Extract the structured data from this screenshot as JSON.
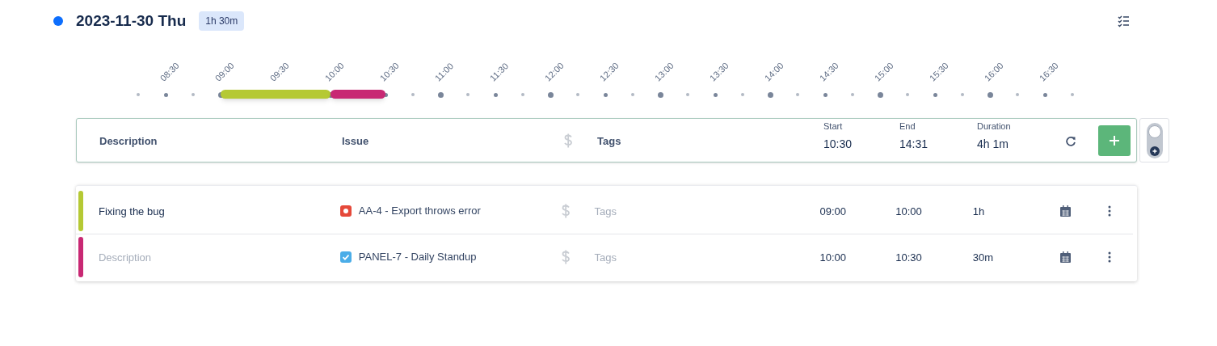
{
  "day": {
    "title": "2023-11-30 Thu",
    "total": "1h 30m",
    "color": "#0d6efd"
  },
  "timeline": {
    "ticks": [
      "08:30",
      "09:00",
      "09:30",
      "10:00",
      "10:30",
      "11:00",
      "11:30",
      "12:00",
      "12:30",
      "13:00",
      "13:30",
      "14:00",
      "14:30",
      "15:00",
      "15:30",
      "16:00",
      "16:30"
    ]
  },
  "form": {
    "description_placeholder": "Description",
    "issue_placeholder": "Issue",
    "tags_placeholder": "Tags",
    "start_label": "Start",
    "start": "10:30",
    "end_label": "End",
    "end": "14:31",
    "duration_label": "Duration",
    "duration": "4h 1m",
    "toggle_on": false
  },
  "rows": [
    {
      "color": "#b5c934",
      "description": "Fixing the bug",
      "kind": "bug",
      "issue": "AA-4 - Export throws error",
      "tags_placeholder": "Tags",
      "start": "09:00",
      "end": "10:00",
      "duration": "1h"
    },
    {
      "color": "#c82873",
      "placeholder": "Description",
      "kind": "task",
      "issue": "PANEL-7 - Daily Standup",
      "tags_placeholder": "Tags",
      "start": "10:00",
      "end": "10:30",
      "duration": "30m"
    }
  ]
}
